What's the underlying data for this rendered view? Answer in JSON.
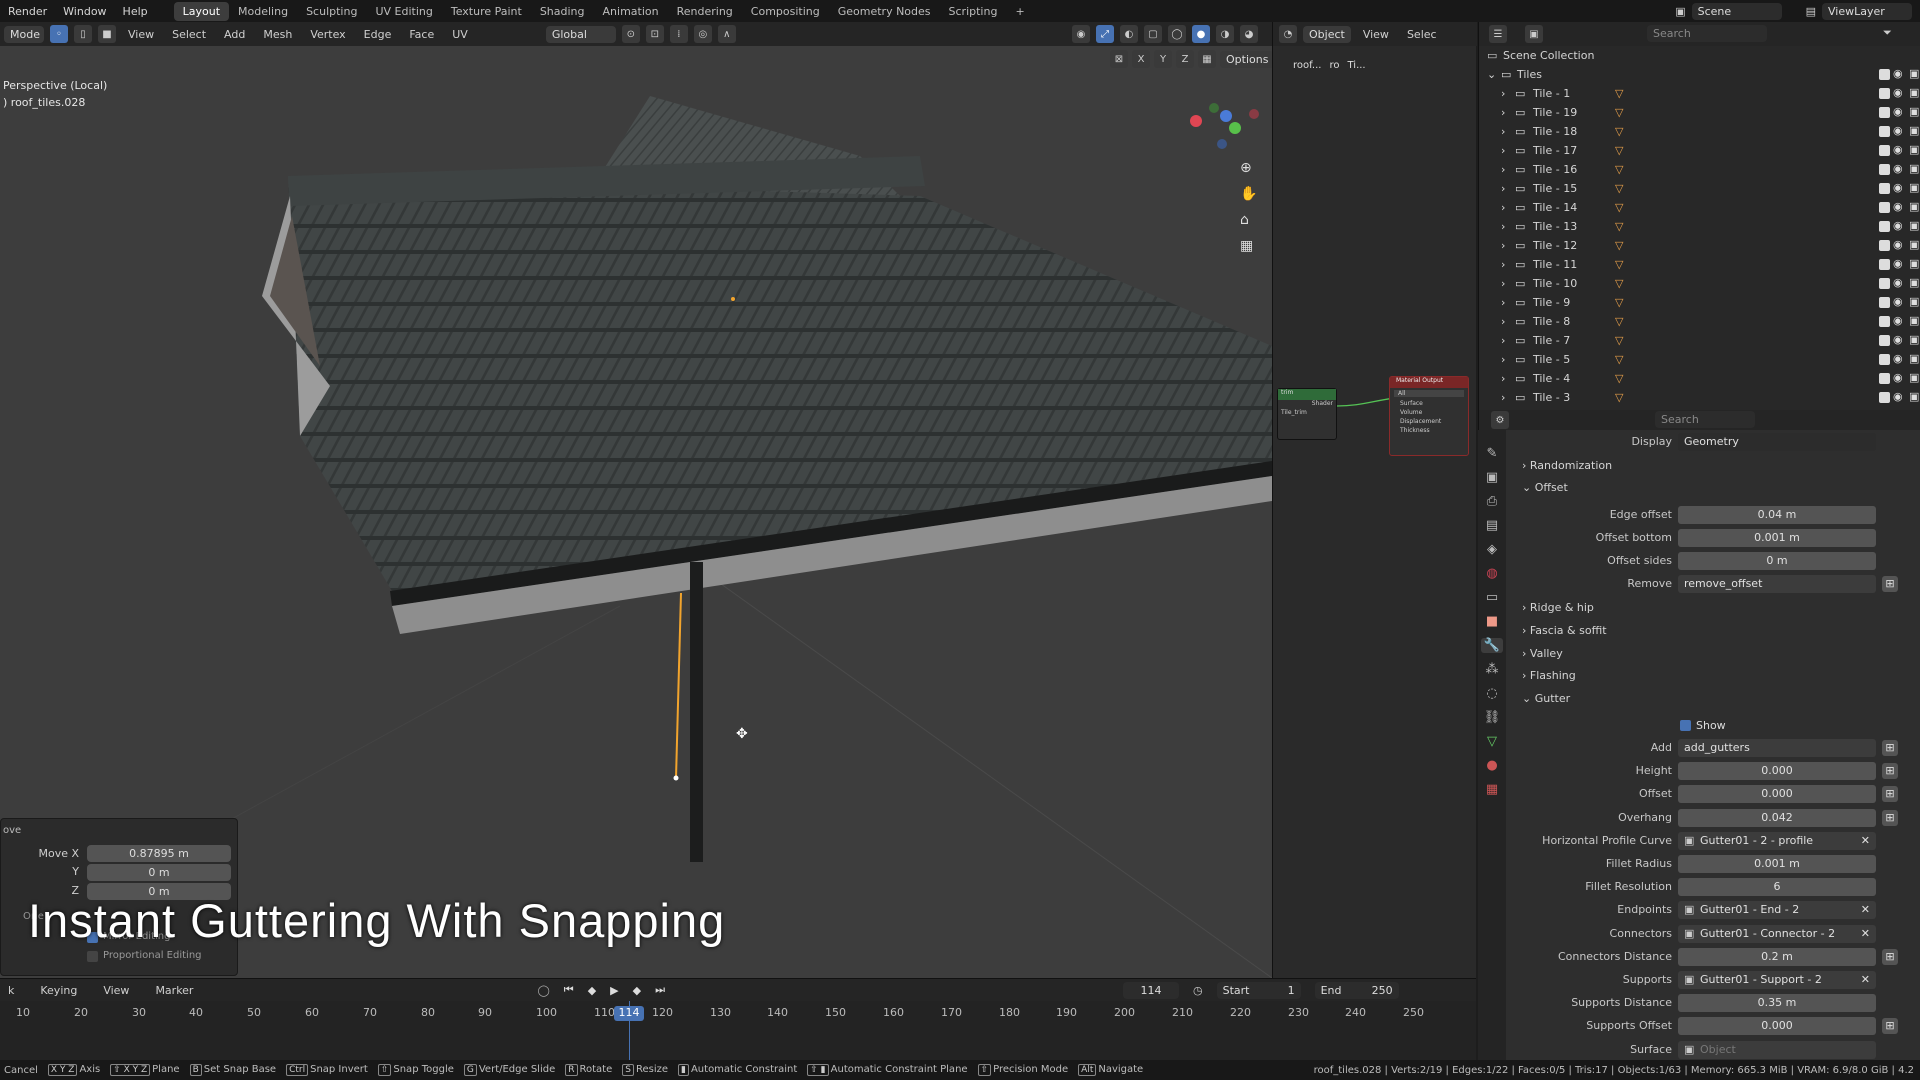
{
  "topbar": {
    "menus": [
      "Render",
      "Window",
      "Help"
    ],
    "workspaces": [
      "Layout",
      "Modeling",
      "Sculpting",
      "UV Editing",
      "Texture Paint",
      "Shading",
      "Animation",
      "Rendering",
      "Compositing",
      "Geometry Nodes",
      "Scripting"
    ],
    "active_workspace": "Layout",
    "add_tab": "+",
    "scene": "Scene",
    "viewlayer": "ViewLayer"
  },
  "viewport_header": {
    "mode": "Mode",
    "menus": [
      "View",
      "Select",
      "Add",
      "Mesh",
      "Vertex",
      "Edge",
      "Face",
      "UV"
    ],
    "orientation": "Global",
    "options": "Options",
    "axes": [
      "X",
      "Y",
      "Z"
    ]
  },
  "viewport": {
    "view_name": "Perspective (Local)",
    "object_name": ") roof_tiles.028"
  },
  "node_editor": {
    "object_mode": "Object",
    "view": "View",
    "select": "Selec",
    "breadcrumb": [
      "roof...",
      "ro",
      "Ti..."
    ],
    "material_output": "Material Output",
    "target": "All",
    "sockets": [
      "Surface",
      "Volume",
      "Displacement",
      "Thickness"
    ],
    "left_node_out": "Shader",
    "left_node_in": "Tile_trim",
    "left_node_title": "trim"
  },
  "outliner": {
    "search_placeholder": "Search",
    "scene_collection": "Scene Collection",
    "collection": "Tiles",
    "items": [
      "Tile - 1",
      "Tile - 19",
      "Tile - 18",
      "Tile - 17",
      "Tile - 16",
      "Tile - 15",
      "Tile - 14",
      "Tile - 13",
      "Tile - 12",
      "Tile - 11",
      "Tile - 10",
      "Tile - 9",
      "Tile - 8",
      "Tile - 7",
      "Tile - 5",
      "Tile - 4",
      "Tile - 3"
    ]
  },
  "properties": {
    "search_placeholder": "Search",
    "display_label": "Display",
    "display_value": "Geometry",
    "sections": {
      "randomization": "Randomization",
      "offset": "Offset",
      "ridge": "Ridge & hip",
      "fascia": "Fascia & soffit",
      "valley": "Valley",
      "flashing": "Flashing",
      "gutter": "Gutter"
    },
    "offset_fields": [
      {
        "label": "Edge offset",
        "value": "0.04 m"
      },
      {
        "label": "Offset bottom",
        "value": "0.001 m"
      },
      {
        "label": "Offset sides",
        "value": "0 m"
      },
      {
        "label": "Remove",
        "value": "remove_offset"
      }
    ],
    "gutter_show": "Show",
    "gutter_fields": [
      {
        "label": "Add",
        "value": "add_gutters"
      },
      {
        "label": "Height",
        "value": "0.000"
      },
      {
        "label": "Offset",
        "value": "0.000"
      },
      {
        "label": "Overhang",
        "value": "0.042"
      },
      {
        "label": "Horizontal Profile Curve",
        "value": "Gutter01 - 2 - profile"
      },
      {
        "label": "Fillet Radius",
        "value": "0.001 m"
      },
      {
        "label": "Fillet Resolution",
        "value": "6"
      },
      {
        "label": "Endpoints",
        "value": "Gutter01 - End - 2"
      },
      {
        "label": "Connectors",
        "value": "Gutter01 - Connector - 2"
      },
      {
        "label": "Connectors Distance",
        "value": "0.2 m"
      },
      {
        "label": "Supports",
        "value": "Gutter01 - Support - 2"
      },
      {
        "label": "Supports Distance",
        "value": "0.35 m"
      },
      {
        "label": "Supports Offset",
        "value": "0.000"
      },
      {
        "label": "Surface",
        "value": "Object"
      }
    ]
  },
  "operator_panel": {
    "title": "ove",
    "fields": [
      {
        "label": "Move X",
        "value": "0.87895 m"
      },
      {
        "label": "Y",
        "value": "0 m"
      },
      {
        "label": "Z",
        "value": "0 m"
      }
    ],
    "mirror": "Mirror Editing",
    "proportional": "Proportional Editing",
    "orientation_label": "Orie"
  },
  "caption": "Instant Guttering With Snapping",
  "timeline": {
    "menus": [
      "k",
      "Keying",
      "View",
      "Marker"
    ],
    "current_frame": "114",
    "start_label": "Start",
    "start": "1",
    "end_label": "End",
    "end": "250",
    "ticks": [
      "10",
      "20",
      "30",
      "40",
      "50",
      "60",
      "70",
      "80",
      "90",
      "100",
      "110",
      "120",
      "130",
      "140",
      "150",
      "160",
      "170",
      "180",
      "190",
      "200",
      "210",
      "220",
      "230",
      "240",
      "250"
    ]
  },
  "statusbar": {
    "items": [
      {
        "key": "",
        "label": "Cancel"
      },
      {
        "key": "X Y Z",
        "label": "Axis"
      },
      {
        "key": "⇧ X Y Z",
        "label": "Plane"
      },
      {
        "key": "B",
        "label": "Set Snap Base"
      },
      {
        "key": "Ctrl",
        "label": "Snap Invert"
      },
      {
        "key": "⇧",
        "label": "Snap Toggle"
      },
      {
        "key": "G",
        "label": "Vert/Edge Slide"
      },
      {
        "key": "R",
        "label": "Rotate"
      },
      {
        "key": "S",
        "label": "Resize"
      },
      {
        "key": "▮",
        "label": "Automatic Constraint"
      },
      {
        "key": "⇧ ▮",
        "label": "Automatic Constraint Plane"
      },
      {
        "key": "⇧",
        "label": "Precision Mode"
      },
      {
        "key": "Alt",
        "label": "Navigate"
      }
    ],
    "stats": "roof_tiles.028 | Verts:2/19 | Edges:1/22 | Faces:0/5 | Tris:17 | Objects:1/63 | Memory: 665.3 MiB | VRAM: 6.9/8.0 GiB | 4.2"
  },
  "colors": {
    "accent": "#4772b3",
    "tile_warning": "#e8a04a",
    "selected_edge": "#f2a42d",
    "node_green": "#55c355"
  }
}
